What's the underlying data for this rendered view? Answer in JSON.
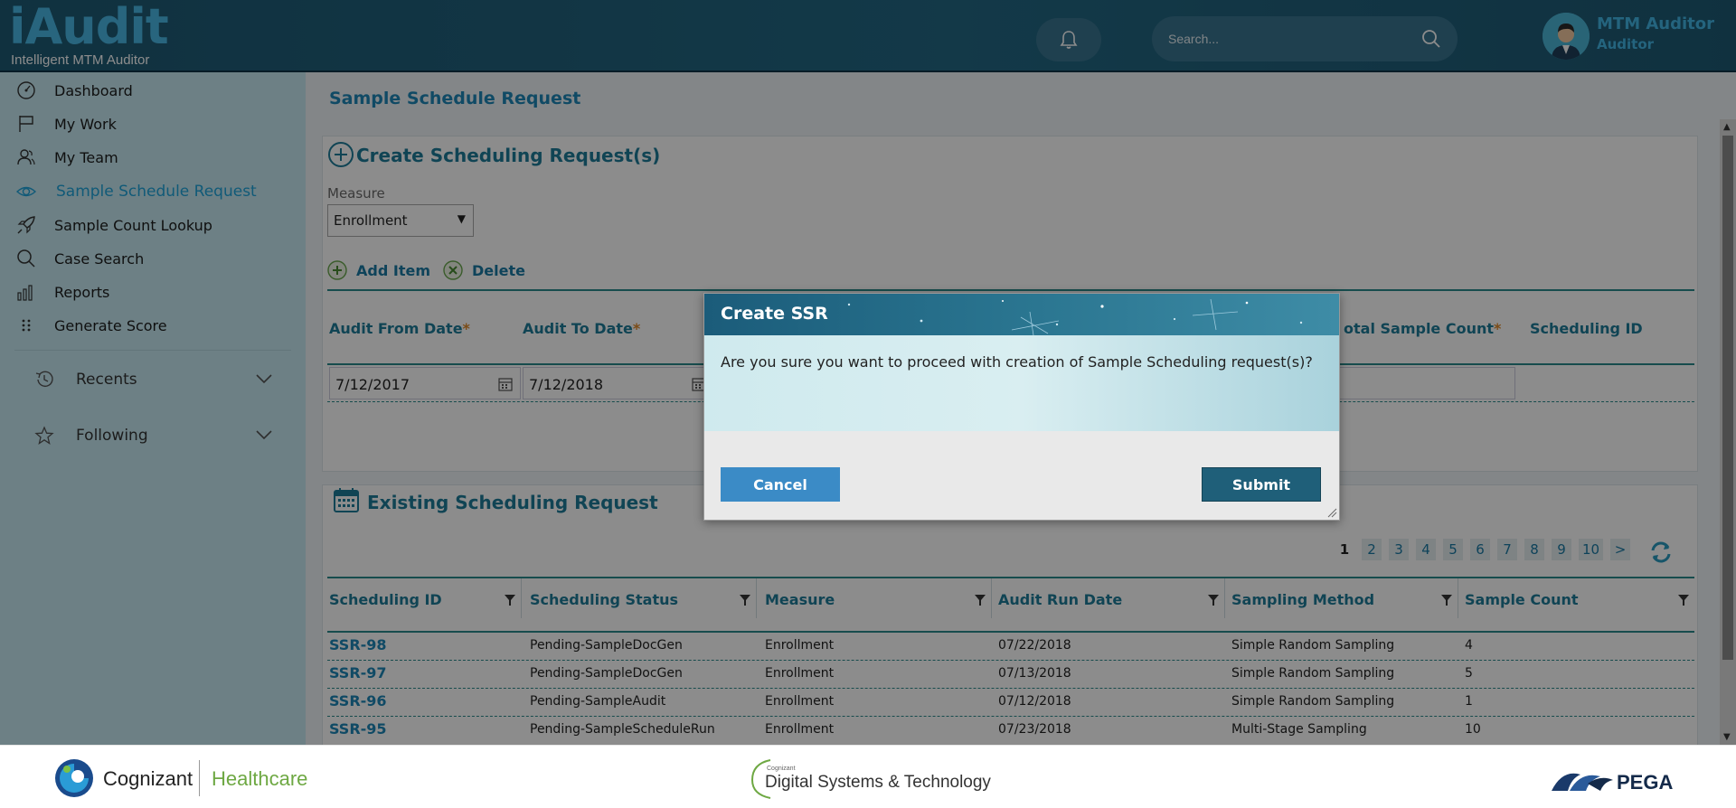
{
  "header": {
    "logo_main": "iAudit",
    "logo_sub": "Intelligent MTM Auditor",
    "search_placeholder": "Search...",
    "user_name": "MTM Auditor",
    "user_role": "Auditor"
  },
  "sidebar": {
    "items": [
      {
        "label": "Dashboard",
        "icon": "dashboard-icon"
      },
      {
        "label": "My Work",
        "icon": "flag-icon"
      },
      {
        "label": "My Team",
        "icon": "team-icon"
      },
      {
        "label": "Sample Schedule Request",
        "icon": "eye-icon",
        "active": true
      },
      {
        "label": "Sample Count Lookup",
        "icon": "rocket-icon"
      },
      {
        "label": "Case Search",
        "icon": "search-icon"
      },
      {
        "label": "Reports",
        "icon": "bar-chart-icon"
      },
      {
        "label": "Generate Score",
        "icon": "grid-dots-icon"
      }
    ],
    "recents_label": "Recents",
    "following_label": "Following"
  },
  "main": {
    "page_title": "Sample Schedule Request",
    "create_title": "Create Scheduling Request(s)",
    "measure_label": "Measure",
    "measure_value": "Enrollment",
    "add_item_label": "Add Item",
    "delete_label": "Delete",
    "columns": {
      "audit_from": "Audit From Date",
      "audit_to": "Audit To Date",
      "total_sample": "otal Sample Count",
      "scheduling_id": "Scheduling ID"
    },
    "row": {
      "audit_from": "7/12/2017",
      "audit_to": "7/12/2018"
    },
    "existing_title": "Existing Scheduling Request",
    "pager": [
      "1",
      "2",
      "3",
      "4",
      "5",
      "6",
      "7",
      "8",
      "9",
      "10",
      ">"
    ],
    "table": {
      "headers": [
        "Scheduling ID",
        "Scheduling Status",
        "Measure",
        "Audit Run Date",
        "Sampling Method",
        "Sample Count"
      ],
      "rows": [
        [
          "SSR-98",
          "Pending-SampleDocGen",
          "Enrollment",
          "07/22/2018",
          "Simple Random Sampling",
          "4"
        ],
        [
          "SSR-97",
          "Pending-SampleDocGen",
          "Enrollment",
          "07/13/2018",
          "Simple Random Sampling",
          "5"
        ],
        [
          "SSR-96",
          "Pending-SampleAudit",
          "Enrollment",
          "07/12/2018",
          "Simple Random Sampling",
          "1"
        ],
        [
          "SSR-95",
          "Pending-SampleScheduleRun",
          "Enrollment",
          "07/23/2018",
          "Multi-Stage Sampling",
          "10"
        ]
      ]
    }
  },
  "modal": {
    "title": "Create SSR",
    "message": "Are you sure you want to proceed with creation of Sample Scheduling request(s)?",
    "cancel_label": "Cancel",
    "submit_label": "Submit"
  },
  "footer": {
    "cognizant": "Cognizant",
    "healthcare": "Healthcare",
    "dst_small": "Cognizant",
    "dst": "Digital Systems & Technology",
    "pega": "PEGA"
  },
  "colors": {
    "header_bg": "#236884",
    "sidebar_bg": "#c6eaf2",
    "accent": "#1e88b8",
    "heading_teal": "#1e7d9a",
    "submit_bg": "#1f5f79",
    "cancel_bg": "#3b8bc6"
  }
}
